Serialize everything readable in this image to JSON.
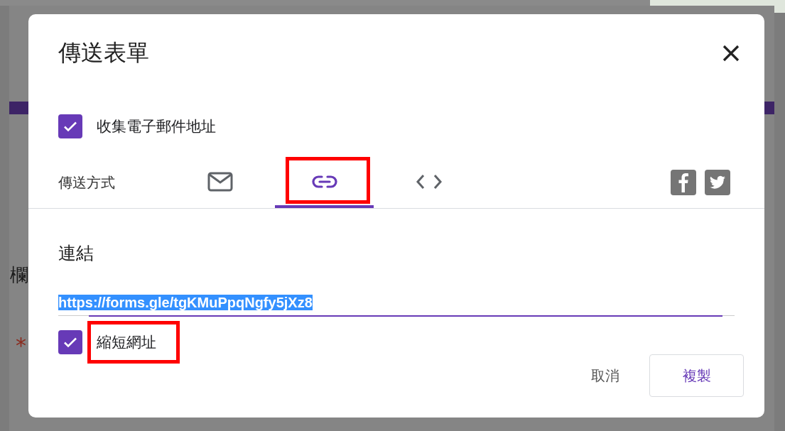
{
  "background": {
    "fragments": [
      {
        "text": "欄",
        "kind": "left"
      },
      {
        "text": "*",
        "kind": "required"
      }
    ]
  },
  "dialog": {
    "title": "傳送表單",
    "collect_email": {
      "label": "收集電子郵件地址",
      "checked": true
    },
    "send_via": {
      "label": "傳送方式",
      "tabs": [
        {
          "kind": "email",
          "selected": false
        },
        {
          "kind": "link",
          "selected": true,
          "highlighted": true
        },
        {
          "kind": "embed",
          "selected": false
        }
      ]
    },
    "link": {
      "heading": "連結",
      "value": "https://forms.gle/tgKMuPpqNgfy5jXz8",
      "shorten": {
        "label": "縮短網址",
        "checked": true,
        "highlighted": true
      }
    },
    "buttons": [
      {
        "label": "取消",
        "kind": "text"
      },
      {
        "label": "複製",
        "kind": "outlined"
      }
    ]
  }
}
